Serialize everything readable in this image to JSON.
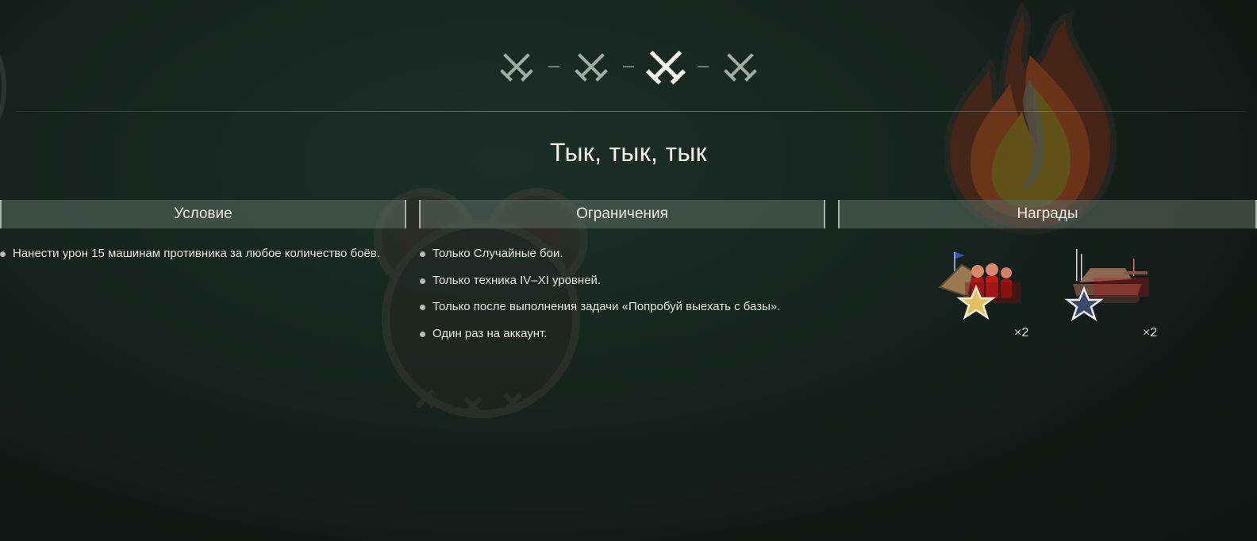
{
  "stages": {
    "items": [
      {
        "icon": "crossed-swords-icon",
        "state": "inactive"
      },
      {
        "icon": "crossed-swords-icon",
        "state": "inactive"
      },
      {
        "icon": "crossed-swords-icon",
        "state": "active"
      },
      {
        "icon": "crossed-swords-icon",
        "state": "inactive"
      }
    ]
  },
  "mission": {
    "title": "Тык, тык, тык"
  },
  "columns": {
    "condition": "Условие",
    "restrictions": "Ограничения",
    "rewards": "Награды"
  },
  "condition_items": [
    "Нанести урон 15 машинам противника за любое количество боёв."
  ],
  "restriction_items": [
    "Только Случайные бои.",
    "Только техника IV–XI уровней.",
    "Только после выполнения задачи «Попробуй выехать с базы».",
    "Один раз на аккаунт."
  ],
  "rewards": [
    {
      "icon": "crew-reward-gold-star-icon",
      "count": "×2"
    },
    {
      "icon": "tank-reward-silver-star-icon",
      "count": "×2"
    }
  ],
  "colors": {
    "accent_active": "#f2f2ee",
    "icon_inactive": "#a3aba6",
    "header_bg": "#5c6c64"
  }
}
